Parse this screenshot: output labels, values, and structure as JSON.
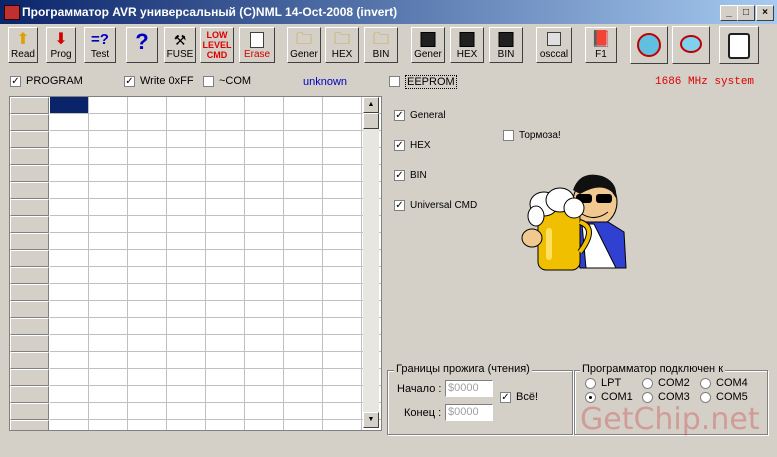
{
  "window": {
    "title": "Программатор AVR универсальный (C)NML 14-Oct-2008 (invert)",
    "min": "_",
    "max": "□",
    "close": "×"
  },
  "toolbar": [
    {
      "label": "Read"
    },
    {
      "label": "Prog"
    },
    {
      "label": "Test"
    },
    {
      "label": ""
    },
    {
      "label": "FUSE"
    },
    {
      "label": "LOW LEVEL CMD"
    },
    {
      "label": "Erase"
    },
    {
      "label": "Gener"
    },
    {
      "label": "HEX"
    },
    {
      "label": "BIN"
    },
    {
      "label": "Gener"
    },
    {
      "label": "HEX"
    },
    {
      "label": "BIN"
    },
    {
      "label": "osccal"
    },
    {
      "label": "F1"
    },
    {
      "label": ""
    },
    {
      "label": ""
    },
    {
      "label": ""
    }
  ],
  "options": {
    "program": "PROGRAM",
    "write_ff": "Write 0xFF",
    "com_inv": "~COM",
    "status": "unknown",
    "eeprom": "EEPROM",
    "mhz": "1686 MHz system"
  },
  "checks": {
    "general": "General",
    "hex": "HEX",
    "bin": "BIN",
    "universal": "Universal CMD",
    "slow": "Тормоза!"
  },
  "bounds": {
    "legend": "Границы прожига (чтения)",
    "start_label": "Начало :",
    "start_value": "$0000",
    "end_label": "Конец :",
    "end_value": "$0000",
    "all_label": "Всё!"
  },
  "port": {
    "legend": "Программатор подключен к",
    "items": [
      "LPT",
      "COM2",
      "COM4",
      "COM1",
      "COM3",
      "COM5"
    ],
    "selected": "COM1"
  },
  "watermark": "GetChip.net"
}
